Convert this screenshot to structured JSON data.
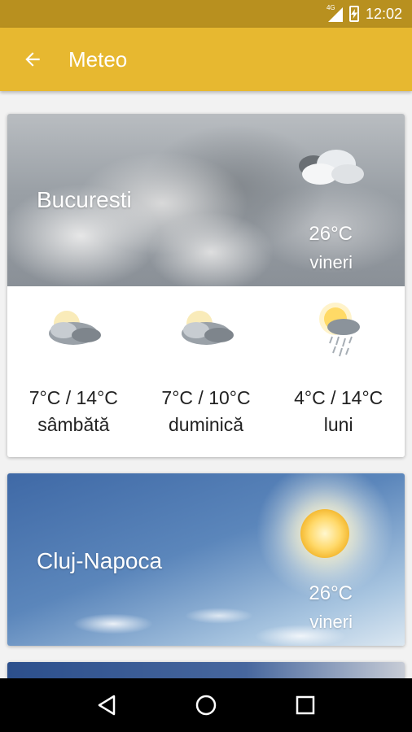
{
  "status_bar": {
    "network": "4G",
    "time": "12:02"
  },
  "app_bar": {
    "title": "Meteo",
    "back_icon": "arrow-left-icon"
  },
  "cities": [
    {
      "name": "Bucuresti",
      "temp": "26°C",
      "day": "vineri",
      "condition_icon": "cloudy-icon",
      "forecast": [
        {
          "range": "7°C  /  14°C",
          "day": "sâmbătă",
          "icon": "cloudy-partly-sunny-icon"
        },
        {
          "range": "7°C  /  10°C",
          "day": "duminică",
          "icon": "cloudy-partly-sunny-icon"
        },
        {
          "range": "4°C  /  14°C",
          "day": "luni",
          "icon": "rain-sun-icon"
        }
      ]
    },
    {
      "name": "Cluj-Napoca",
      "temp": "26°C",
      "day": "vineri",
      "condition_icon": "sun-icon"
    }
  ],
  "nav": {
    "back_icon": "nav-back-icon",
    "home_icon": "nav-home-icon",
    "recents_icon": "nav-recents-icon"
  },
  "colors": {
    "status_bar": "#b8901f",
    "app_bar": "#e7b830",
    "card_bg": "#ffffff",
    "page_bg": "#f2f2f2"
  }
}
